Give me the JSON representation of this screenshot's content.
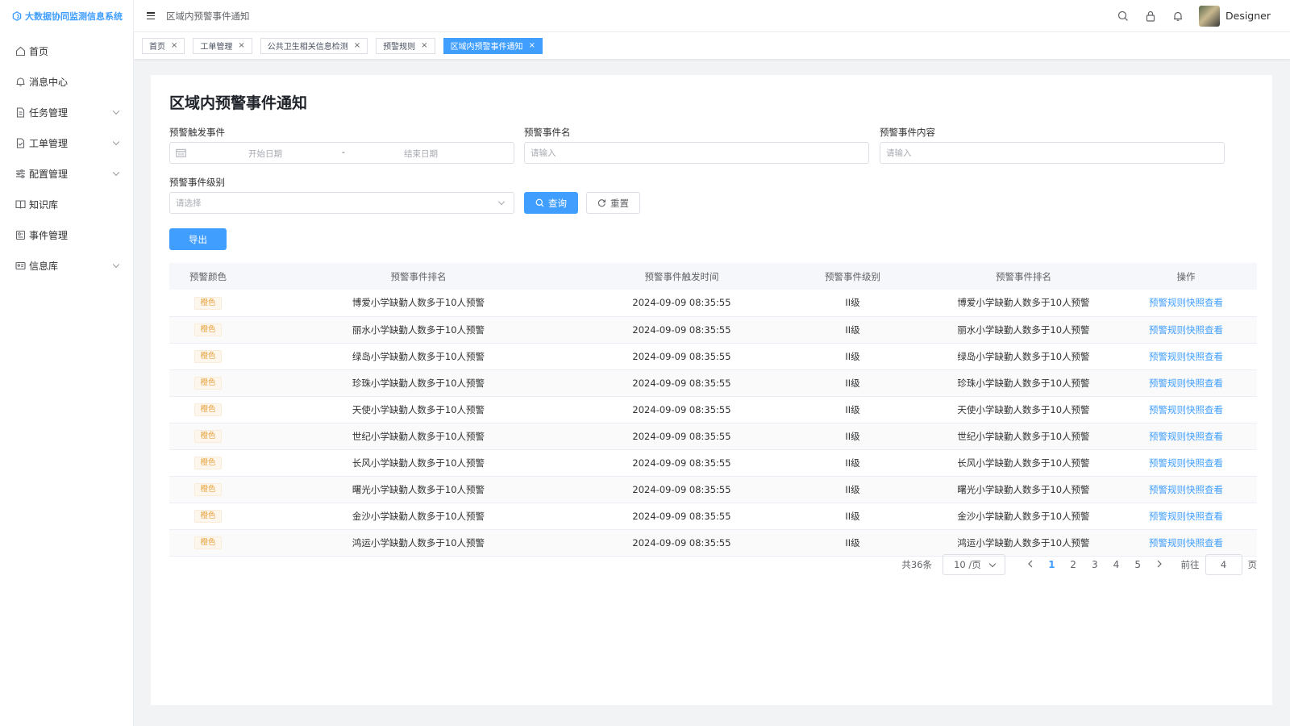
{
  "app": {
    "title": "大数据协同监测信息系统"
  },
  "sidebar": {
    "items": [
      {
        "label": "首页",
        "icon": "home-icon",
        "expandable": false
      },
      {
        "label": "消息中心",
        "icon": "bell-icon",
        "expandable": false
      },
      {
        "label": "任务管理",
        "icon": "document-icon",
        "expandable": true
      },
      {
        "label": "工单管理",
        "icon": "file-check-icon",
        "expandable": true
      },
      {
        "label": "配置管理",
        "icon": "sliders-icon",
        "expandable": true
      },
      {
        "label": "知识库",
        "icon": "book-icon",
        "expandable": false
      },
      {
        "label": "事件管理",
        "icon": "event-icon",
        "expandable": false
      },
      {
        "label": "信息库",
        "icon": "id-card-icon",
        "expandable": true
      }
    ]
  },
  "header": {
    "breadcrumb": "区域内预警事件通知",
    "username": "Designer"
  },
  "tags": [
    {
      "label": "首页",
      "active": false
    },
    {
      "label": "工单管理",
      "active": false
    },
    {
      "label": "公共卫生相关信息检测",
      "active": false
    },
    {
      "label": "预警规则",
      "active": false
    },
    {
      "label": "区域内预警事件通知",
      "active": true
    }
  ],
  "tag_close": "×",
  "page": {
    "title": "区域内预警事件通知"
  },
  "filters": {
    "trigger_label": "预警触发事件",
    "start_placeholder": "开始日期",
    "range_separator": "-",
    "end_placeholder": "结束日期",
    "name_label": "预警事件名",
    "name_placeholder": "请输入",
    "content_label": "预警事件内容",
    "content_placeholder": "请输入",
    "level_label": "预警事件级别",
    "level_placeholder": "请选择"
  },
  "buttons": {
    "query": "查询",
    "reset": "重置",
    "export": "导出"
  },
  "table": {
    "headers": [
      "预警颜色",
      "预警事件排名",
      "预警事件触发时间",
      "预警事件级别",
      "预警事件排名",
      "操作"
    ],
    "rows": [
      {
        "color": "橙色",
        "name": "博爱小学缺勤人数多于10人预警",
        "time": "2024-09-09 08:35:55",
        "level": "II级",
        "rank": "博爱小学缺勤人数多于10人预警",
        "action": "预警规则快照查看"
      },
      {
        "color": "橙色",
        "name": "丽水小学缺勤人数多于10人预警",
        "time": "2024-09-09 08:35:55",
        "level": "II级",
        "rank": "丽水小学缺勤人数多于10人预警",
        "action": "预警规则快照查看"
      },
      {
        "color": "橙色",
        "name": "绿岛小学缺勤人数多于10人预警",
        "time": "2024-09-09 08:35:55",
        "level": "II级",
        "rank": "绿岛小学缺勤人数多于10人预警",
        "action": "预警规则快照查看"
      },
      {
        "color": "橙色",
        "name": "珍珠小学缺勤人数多于10人预警",
        "time": "2024-09-09 08:35:55",
        "level": "II级",
        "rank": "珍珠小学缺勤人数多于10人预警",
        "action": "预警规则快照查看"
      },
      {
        "color": "橙色",
        "name": "天使小学缺勤人数多于10人预警",
        "time": "2024-09-09 08:35:55",
        "level": "II级",
        "rank": "天使小学缺勤人数多于10人预警",
        "action": "预警规则快照查看"
      },
      {
        "color": "橙色",
        "name": "世纪小学缺勤人数多于10人预警",
        "time": "2024-09-09 08:35:55",
        "level": "II级",
        "rank": "世纪小学缺勤人数多于10人预警",
        "action": "预警规则快照查看"
      },
      {
        "color": "橙色",
        "name": "长风小学缺勤人数多于10人预警",
        "time": "2024-09-09 08:35:55",
        "level": "II级",
        "rank": "长风小学缺勤人数多于10人预警",
        "action": "预警规则快照查看"
      },
      {
        "color": "橙色",
        "name": "曙光小学缺勤人数多于10人预警",
        "time": "2024-09-09 08:35:55",
        "level": "II级",
        "rank": "曙光小学缺勤人数多于10人预警",
        "action": "预警规则快照查看"
      },
      {
        "color": "橙色",
        "name": "金沙小学缺勤人数多于10人预警",
        "time": "2024-09-09 08:35:55",
        "level": "II级",
        "rank": "金沙小学缺勤人数多于10人预警",
        "action": "预警规则快照查看"
      },
      {
        "color": "橙色",
        "name": "鸿运小学缺勤人数多于10人预警",
        "time": "2024-09-09 08:35:55",
        "level": "II级",
        "rank": "鸿运小学缺勤人数多于10人预警",
        "action": "预警规则快照查看"
      }
    ]
  },
  "pagination": {
    "total": "共36条",
    "page_size": "10 /页",
    "pages": [
      "1",
      "2",
      "3",
      "4",
      "5"
    ],
    "current": "1",
    "goto_label": "前往",
    "goto_value": "4",
    "page_suffix": "页"
  },
  "colors": {
    "primary": "#409eff",
    "warning_tag": "#e6a23c",
    "background": "#f2f3f5"
  }
}
